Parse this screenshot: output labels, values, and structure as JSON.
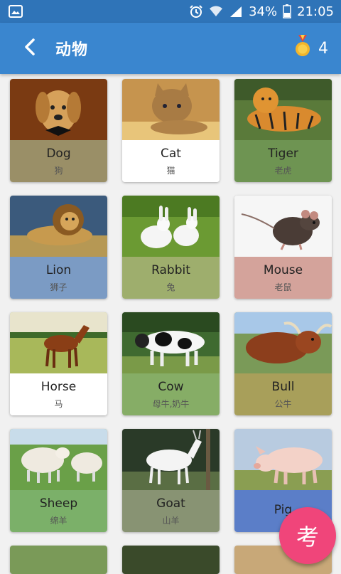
{
  "status_bar": {
    "battery": "34%",
    "time": "21:05",
    "icons": [
      "image-icon",
      "alarm-icon",
      "wifi-icon",
      "signal-icon",
      "battery-icon"
    ]
  },
  "app_bar": {
    "title": "动物",
    "medal_count": "4",
    "icons": [
      "back-arrow-icon",
      "medal-icon"
    ]
  },
  "animals": [
    {
      "en": "Dog",
      "cn": "狗",
      "label_color": "#9a8f67",
      "image": "dog"
    },
    {
      "en": "Cat",
      "cn": "猫",
      "label_color": "#ffffff",
      "image": "cat"
    },
    {
      "en": "Tiger",
      "cn": "老虎",
      "label_color": "#6e9452",
      "image": "tiger"
    },
    {
      "en": "Lion",
      "cn": "狮子",
      "label_color": "#7b9bc4",
      "image": "lion"
    },
    {
      "en": "Rabbit",
      "cn": "兔",
      "label_color": "#9eae6d",
      "image": "rabbit"
    },
    {
      "en": "Mouse",
      "cn": "老鼠",
      "label_color": "#d4a39b",
      "image": "mouse"
    },
    {
      "en": "Horse",
      "cn": "马",
      "label_color": "#ffffff",
      "image": "horse"
    },
    {
      "en": "Cow",
      "cn": "母牛,奶牛",
      "label_color": "#86ad66",
      "image": "cow"
    },
    {
      "en": "Bull",
      "cn": "公牛",
      "label_color": "#a89f5a",
      "image": "bull"
    },
    {
      "en": "Sheep",
      "cn": "绵羊",
      "label_color": "#7bb069",
      "image": "sheep"
    },
    {
      "en": "Goat",
      "cn": "山羊",
      "label_color": "#889373",
      "image": "goat"
    },
    {
      "en": "Pig",
      "cn": "",
      "label_color": "#5b7ec8",
      "image": "pig"
    }
  ],
  "fab": {
    "label": "考",
    "color": "#f0457a"
  },
  "colors": {
    "status_bar": "#2f74b8",
    "app_bar": "#3a86cf",
    "background": "#f1f1f1"
  }
}
